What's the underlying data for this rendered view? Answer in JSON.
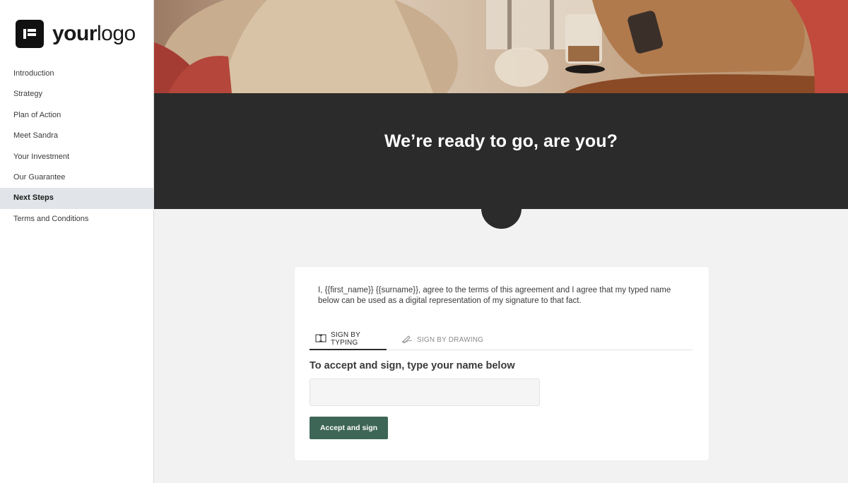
{
  "logo": {
    "text_bold": "your",
    "text_light": "logo"
  },
  "sidebar": {
    "items": [
      {
        "label": "Introduction"
      },
      {
        "label": "Strategy"
      },
      {
        "label": "Plan of Action"
      },
      {
        "label": "Meet Sandra"
      },
      {
        "label": "Your Investment"
      },
      {
        "label": "Our Guarantee"
      },
      {
        "label": "Next Steps"
      },
      {
        "label": "Terms and Conditions"
      }
    ],
    "active_index": 6
  },
  "banner": {
    "heading": "We’re ready to go, are you?"
  },
  "signature": {
    "agreement": "I, {{first_name}} {{surname}}, agree to the terms of this agreement and I agree that my typed name below can be used as a digital representation of my signature to that fact.",
    "tabs": [
      {
        "label": "SIGN BY TYPING",
        "icon": "keyboard-icon",
        "active": true
      },
      {
        "label": "SIGN BY DRAWING",
        "icon": "pen-icon",
        "active": false
      }
    ],
    "prompt": "To accept and sign, type your name below",
    "input_value": "",
    "button_label": "Accept and sign"
  },
  "colors": {
    "banner": "#2b2b2b",
    "button": "#3e6656",
    "active_nav": "#e1e4e8",
    "page_bg": "#f2f2f2"
  }
}
